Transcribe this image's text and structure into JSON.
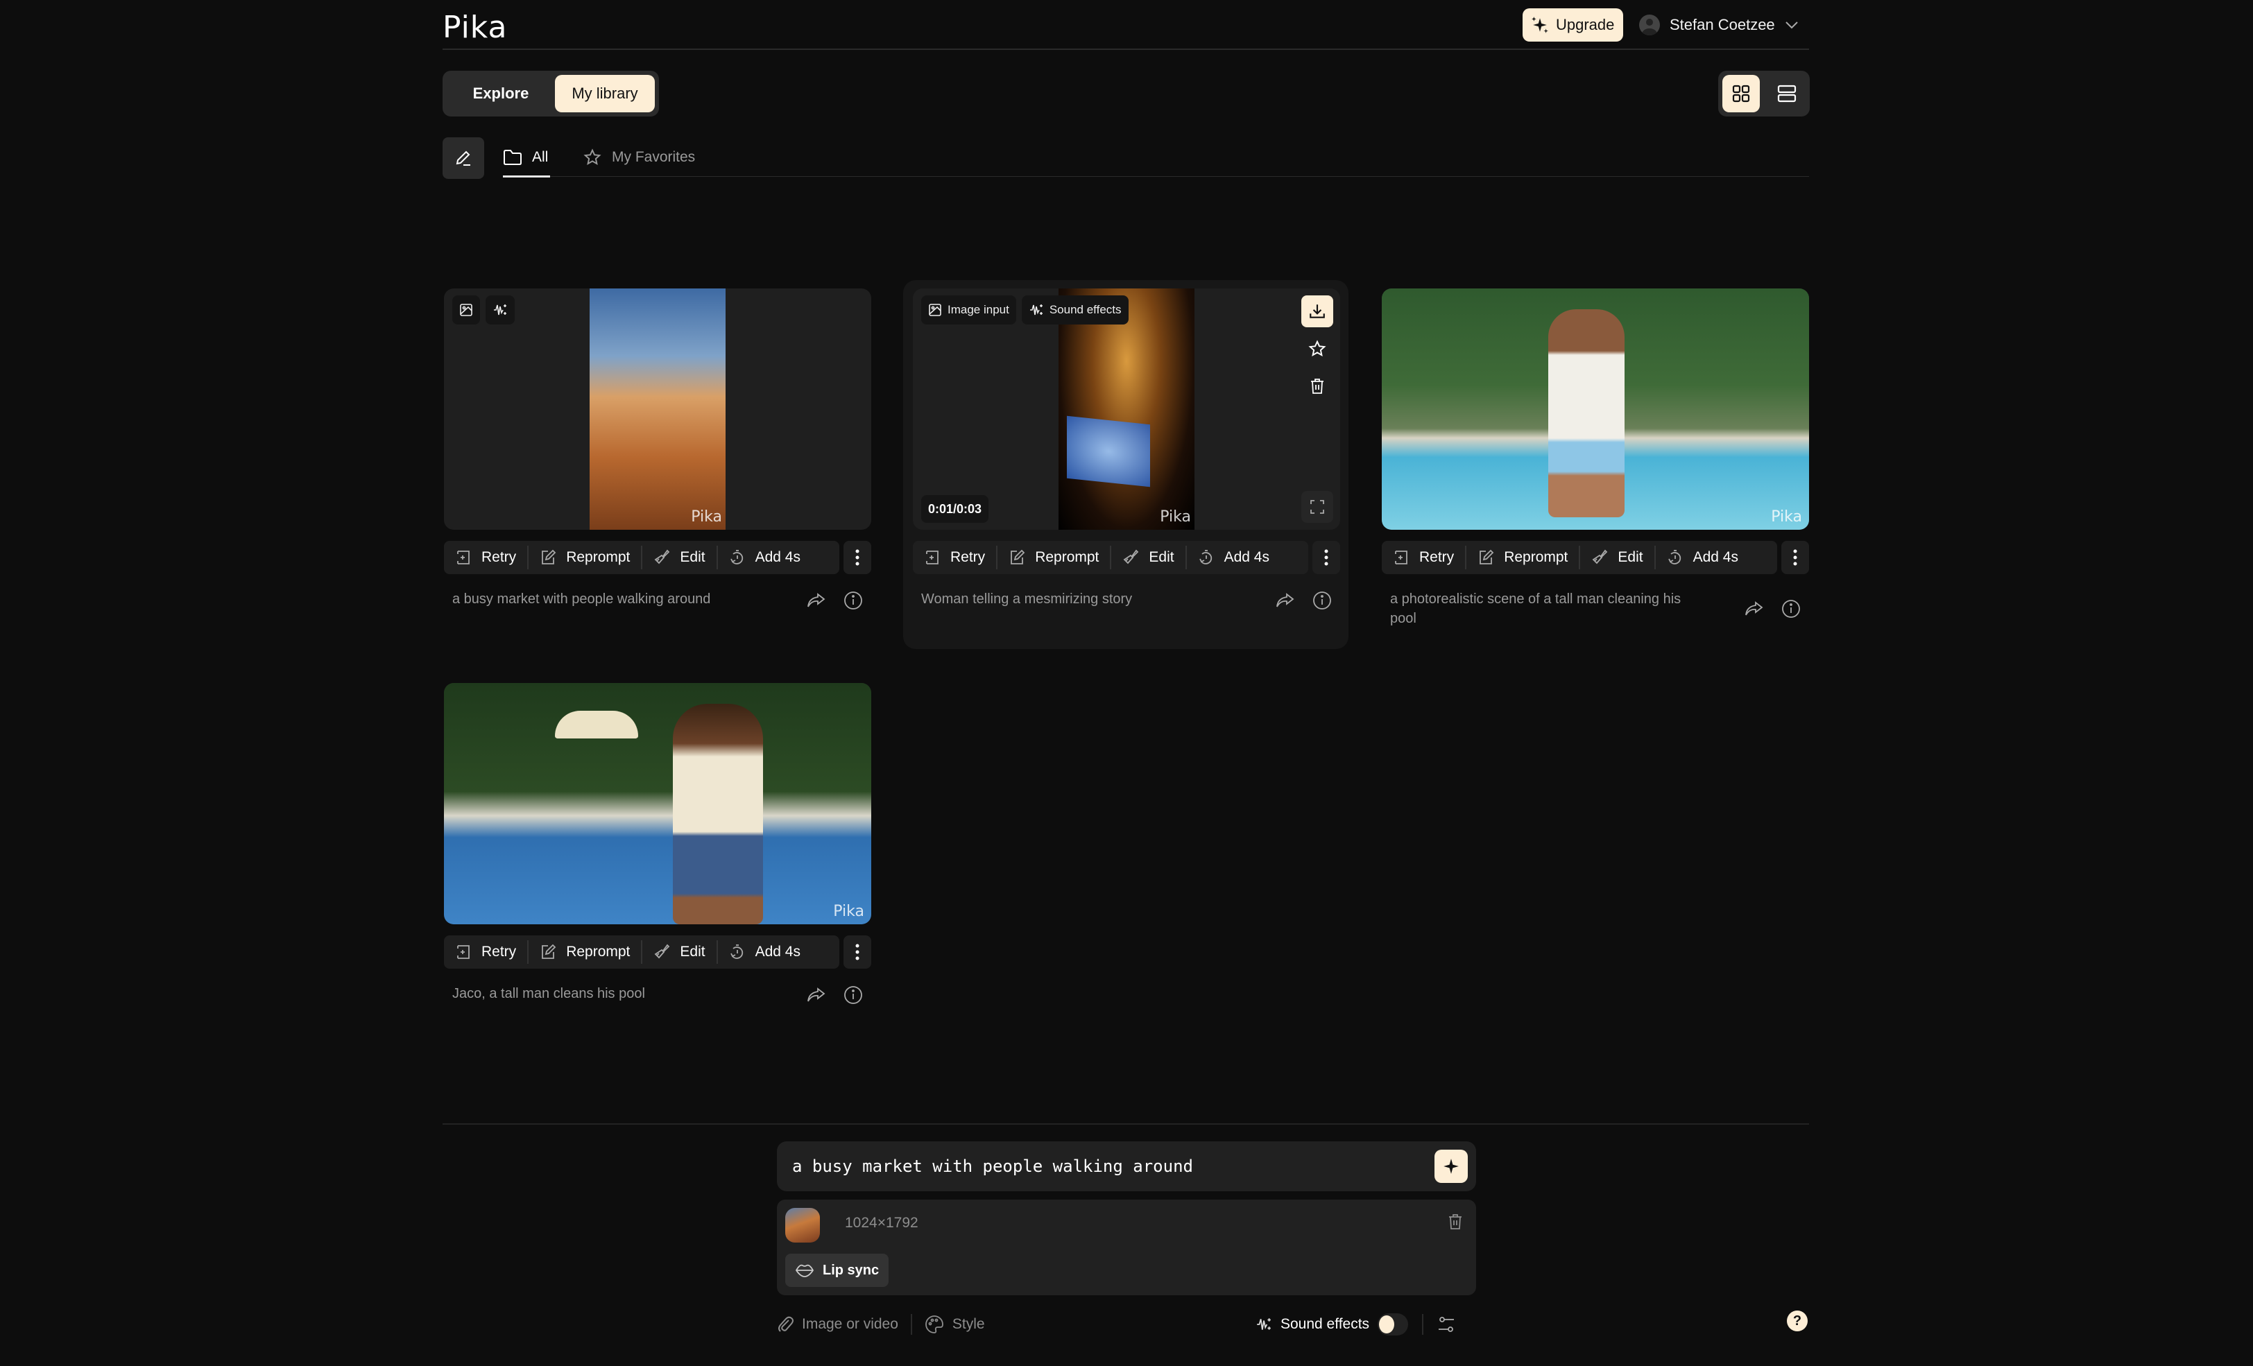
{
  "header": {
    "logo": "Pika",
    "upgrade_label": "Upgrade",
    "user_name": "Stefan Coetzee"
  },
  "nav": {
    "segments": [
      {
        "label": "Explore",
        "active": false
      },
      {
        "label": "My library",
        "active": true
      }
    ],
    "view_modes": [
      "grid-view",
      "list-view"
    ],
    "active_view": "grid-view"
  },
  "tabs": [
    {
      "label": "All",
      "icon": "folder-icon",
      "active": true
    },
    {
      "label": "My Favorites",
      "icon": "star-icon",
      "active": false
    }
  ],
  "toolbar_labels": {
    "retry": "Retry",
    "reprompt": "Reprompt",
    "edit": "Edit",
    "add": "Add 4s"
  },
  "cards": [
    {
      "caption": "a busy market with people walking around",
      "orientation": "portrait",
      "badges": [
        {
          "icon": "image-icon",
          "label": ""
        },
        {
          "icon": "sound-wave-icon",
          "label": ""
        }
      ]
    },
    {
      "caption": "Woman telling a mesmirizing story",
      "orientation": "portrait",
      "hovered": true,
      "timecode": "0:01/0:03",
      "badges": [
        {
          "icon": "image-icon",
          "label": "Image input"
        },
        {
          "icon": "sound-wave-icon",
          "label": "Sound effects"
        }
      ]
    },
    {
      "caption": "a photorealistic scene of a tall man cleaning his pool",
      "orientation": "landscape",
      "badges": []
    },
    {
      "caption": "Jaco, a tall man cleans his pool",
      "orientation": "landscape",
      "badges": []
    }
  ],
  "watermark": "Pika",
  "composer": {
    "prompt_value": "a busy market with people walking around",
    "attachment_size": "1024×1792",
    "lip_sync_label": "Lip sync",
    "image_or_video_label": "Image or video",
    "style_label": "Style",
    "sound_effects_label": "Sound effects",
    "sound_effects_on": false
  },
  "help_label": "?",
  "colors": {
    "accent": "#fdeed6",
    "background": "#0d0d0d",
    "surface": "#1f1f1f"
  }
}
